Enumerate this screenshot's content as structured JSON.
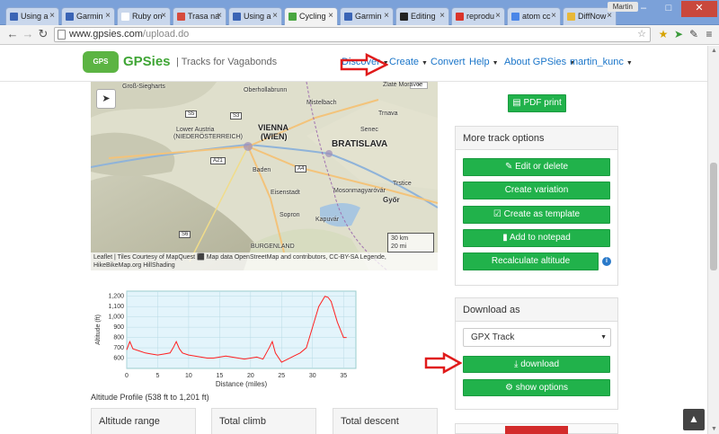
{
  "browser": {
    "tabs": [
      {
        "label": "Using a",
        "icon_color": "#3a64b5",
        "active": false
      },
      {
        "label": "Garmin",
        "icon_color": "#3a64b5",
        "active": false
      },
      {
        "label": "Ruby on",
        "icon_color": "#ffffff",
        "active": false
      },
      {
        "label": "Trasa na",
        "icon_color": "#d64b3d",
        "active": false
      },
      {
        "label": "Using a",
        "icon_color": "#3a64b5",
        "active": false
      },
      {
        "label": "Cycling",
        "icon_color": "#49a640",
        "active": true
      },
      {
        "label": "Garmin",
        "icon_color": "#3a64b5",
        "active": false
      },
      {
        "label": "Editing",
        "icon_color": "#222222",
        "active": false
      },
      {
        "label": "reprodu",
        "icon_color": "#d9342b",
        "active": false
      },
      {
        "label": "atom cc",
        "icon_color": "#4a86e8",
        "active": false
      },
      {
        "label": "DiffNow",
        "icon_color": "#e8b839",
        "active": false
      }
    ],
    "profile_label": "Martin",
    "url_host": "www.gpsies.com",
    "url_path": "/upload.do"
  },
  "header": {
    "logo_text": "GPSies",
    "tagline": "| Tracks for Vagabonds",
    "nav": {
      "discover": "Discover",
      "create": "Create",
      "convert": "Convert",
      "help": "Help",
      "about": "About GPSies",
      "user": "martin_kunc"
    }
  },
  "map": {
    "cities": [
      "VIENNA",
      "(WIEN)",
      "BRATISLAVA"
    ],
    "towns": [
      "Groß-Siegharts",
      "Oberhollabrunn",
      "Mistelbach",
      "Zlaté Moravce",
      "Trnava",
      "Senec",
      "Lower Austria",
      "(NIEDERÖSTERREICH)",
      "Baden",
      "Eisenstadt",
      "Mosonmagyaróvár",
      "Sopron",
      "Kapuvár",
      "Győr",
      "BURGENLAND",
      "Trstice"
    ],
    "roads": [
      "S5",
      "S3",
      "A21",
      "A4",
      "S6"
    ],
    "scale_km": "30 km",
    "scale_mi": "20 mi",
    "attribution": "Leaflet | Tiles Courtesy of MapQuest ⬛ Map data OpenStreetMap and contributors, CC-BY-SA Legende, HikeBikeMap.org HillShading"
  },
  "chart_data": {
    "type": "area",
    "xlabel": "Distance (miles)",
    "ylabel": "Altitude (ft)",
    "xlim": [
      0,
      37
    ],
    "ylim": [
      500,
      1250
    ],
    "xticks": [
      0,
      5,
      10,
      15,
      20,
      25,
      30,
      35
    ],
    "yticks": [
      600,
      700,
      800,
      900,
      1000,
      1100,
      1200
    ],
    "xtick_labels": [
      "0",
      "5",
      "10",
      "15",
      "20",
      "25",
      "30",
      "35"
    ],
    "ytick_labels": [
      "600",
      "700",
      "800",
      "900",
      "1,000",
      "1,100",
      "1,200"
    ],
    "color": "#ff2020",
    "fill": "#e3f4fb",
    "x": [
      0,
      0.5,
      1,
      2,
      3,
      4,
      5,
      6,
      7,
      7.5,
      8,
      8.5,
      9,
      10,
      11,
      12,
      13,
      14,
      15,
      16,
      17,
      18,
      19,
      20,
      21,
      22,
      23,
      23.5,
      24,
      25,
      26,
      27,
      28,
      29,
      30,
      31,
      32,
      32.5,
      33,
      33.5,
      34,
      35,
      35.5
    ],
    "y": [
      680,
      760,
      690,
      670,
      650,
      640,
      630,
      640,
      650,
      700,
      760,
      690,
      650,
      630,
      620,
      610,
      600,
      600,
      610,
      620,
      610,
      600,
      590,
      600,
      610,
      590,
      700,
      760,
      650,
      560,
      590,
      620,
      650,
      700,
      900,
      1100,
      1200,
      1190,
      1150,
      1050,
      950,
      800,
      800
    ]
  },
  "chart_caption": "Altitude Profile (538 ft to 1,201 ft)",
  "stats": [
    "Altitude range",
    "Total climb",
    "Total descent"
  ],
  "sidebar": {
    "pdf_print": "PDF print",
    "more_options_title": "More track options",
    "more_options": [
      "Edit or delete",
      "Create variation",
      "Create as template",
      "Add to notepad"
    ],
    "recalculate": "Recalculate altitude",
    "download_title": "Download as",
    "download_format": "GPX Track",
    "download_button": "download",
    "show_options": "show options"
  }
}
